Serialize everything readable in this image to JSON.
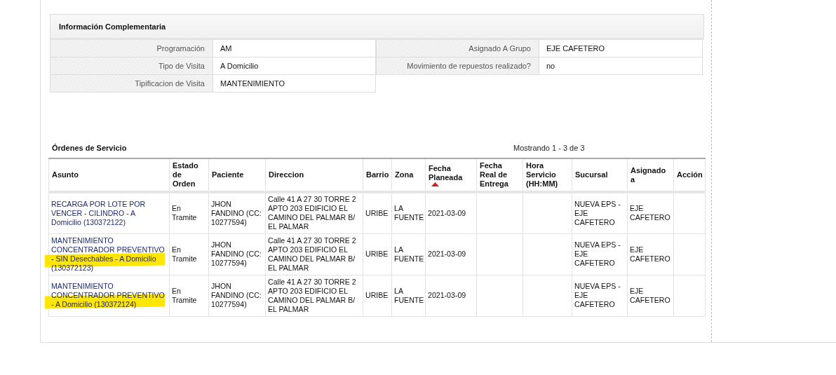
{
  "info_panel": {
    "title": "Información Complementaria",
    "left_fields": [
      {
        "label": "Programación",
        "value": "AM"
      },
      {
        "label": "Tipo de Visita",
        "value": "A Domicilio"
      },
      {
        "label": "Tipificacion de Visita",
        "value": "MANTENIMIENTO"
      }
    ],
    "right_fields": [
      {
        "label": "Asignado A Grupo",
        "value": "EJE CAFETERO"
      },
      {
        "label": "Movimiento de repuestos realizado?",
        "value": "no"
      }
    ]
  },
  "orders": {
    "title": "Órdenes de Servicio",
    "count": "Mostrando 1 - 3 de 3",
    "columns": [
      {
        "label": "Asunto",
        "sorted": false
      },
      {
        "label": "Estado de Orden",
        "sorted": false
      },
      {
        "label": "Paciente",
        "sorted": false
      },
      {
        "label": "Direccion",
        "sorted": false
      },
      {
        "label": "Barrio",
        "sorted": false
      },
      {
        "label": "Zona",
        "sorted": false
      },
      {
        "label": "Fecha Planeada",
        "sorted": true
      },
      {
        "label": "Fecha Real de Entrega",
        "sorted": false
      },
      {
        "label": "Hora Servicio (HH:MM)",
        "sorted": false
      },
      {
        "label": "Sucursal",
        "sorted": false
      },
      {
        "label": "Asignado a",
        "sorted": false
      },
      {
        "label": "Acción",
        "sorted": false
      }
    ],
    "rows": [
      {
        "highlighted": false,
        "cells": [
          "RECARGA POR LOTE POR VENCER - CILINDRO - A Domicilio (130372122)",
          "En Tramite",
          "JHON FANDINO (CC: 10277594)",
          "Calle 41 A 27 30 TORRE 2 APTO 203 EDIFICIO EL CAMINO DEL PALMAR B/ EL PALMAR",
          "URIBE",
          "LA FUENTE",
          "2021-03-09",
          "",
          "",
          "NUEVA EPS - EJE CAFETERO",
          "EJE CAFETERO",
          ""
        ]
      },
      {
        "highlighted": true,
        "cells": [
          "MANTENIMIENTO CONCENTRADOR PREVENTIVO - SIN Desechables - A Domicilio (130372123)",
          "En Tramite",
          "JHON FANDINO (CC: 10277594)",
          "Calle 41 A 27 30 TORRE 2 APTO 203 EDIFICIO EL CAMINO DEL PALMAR B/ EL PALMAR",
          "URIBE",
          "LA FUENTE",
          "2021-03-09",
          "",
          "",
          "NUEVA EPS - EJE CAFETERO",
          "EJE CAFETERO",
          ""
        ]
      },
      {
        "highlighted": true,
        "cells": [
          "MANTENIMIENTO CONCENTRADOR PREVENTIVO - A Domicilio (130372124)",
          "En Tramite",
          "JHON FANDINO (CC: 10277594)",
          "Calle 41 A 27 30 TORRE 2 APTO 203 EDIFICIO EL CAMINO DEL PALMAR B/ EL PALMAR",
          "URIBE",
          "LA FUENTE",
          "2021-03-09",
          "",
          "",
          "NUEVA EPS - EJE CAFETERO",
          "EJE CAFETERO",
          ""
        ]
      }
    ]
  }
}
